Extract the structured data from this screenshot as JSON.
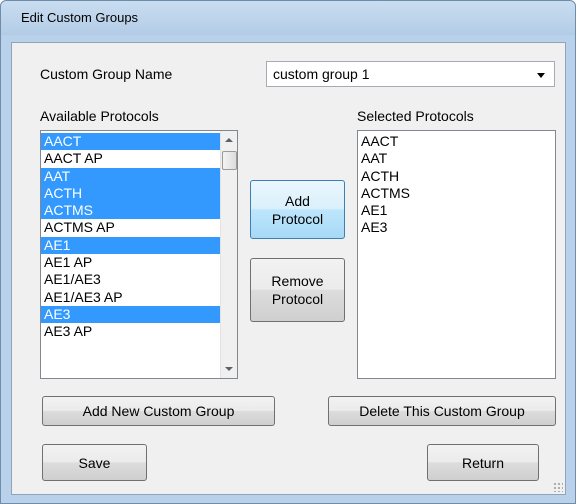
{
  "window": {
    "title": "Edit Custom Groups"
  },
  "group_name": {
    "label": "Custom Group Name",
    "value": "custom group 1"
  },
  "available": {
    "label": "Available Protocols",
    "items": [
      {
        "text": "AACT",
        "selected": true
      },
      {
        "text": "AACT AP",
        "selected": false
      },
      {
        "text": "AAT",
        "selected": true
      },
      {
        "text": "ACTH",
        "selected": true
      },
      {
        "text": "ACTMS",
        "selected": true
      },
      {
        "text": "ACTMS AP",
        "selected": false
      },
      {
        "text": "AE1",
        "selected": true
      },
      {
        "text": "AE1 AP",
        "selected": false
      },
      {
        "text": "AE1/AE3",
        "selected": false
      },
      {
        "text": "AE1/AE3 AP",
        "selected": false
      },
      {
        "text": "AE3",
        "selected": true
      },
      {
        "text": "AE3 AP",
        "selected": false
      }
    ]
  },
  "selected": {
    "label": "Selected Protocols",
    "items": [
      "AACT",
      "AAT",
      "ACTH",
      "ACTMS",
      "AE1",
      "AE3"
    ]
  },
  "buttons": {
    "add_protocol_line1": "Add",
    "add_protocol_line2": "Protocol",
    "remove_protocol_line1": "Remove",
    "remove_protocol_line2": "Protocol",
    "add_group": "Add New Custom Group",
    "delete_group": "Delete This Custom Group",
    "save": "Save",
    "return": "Return"
  }
}
